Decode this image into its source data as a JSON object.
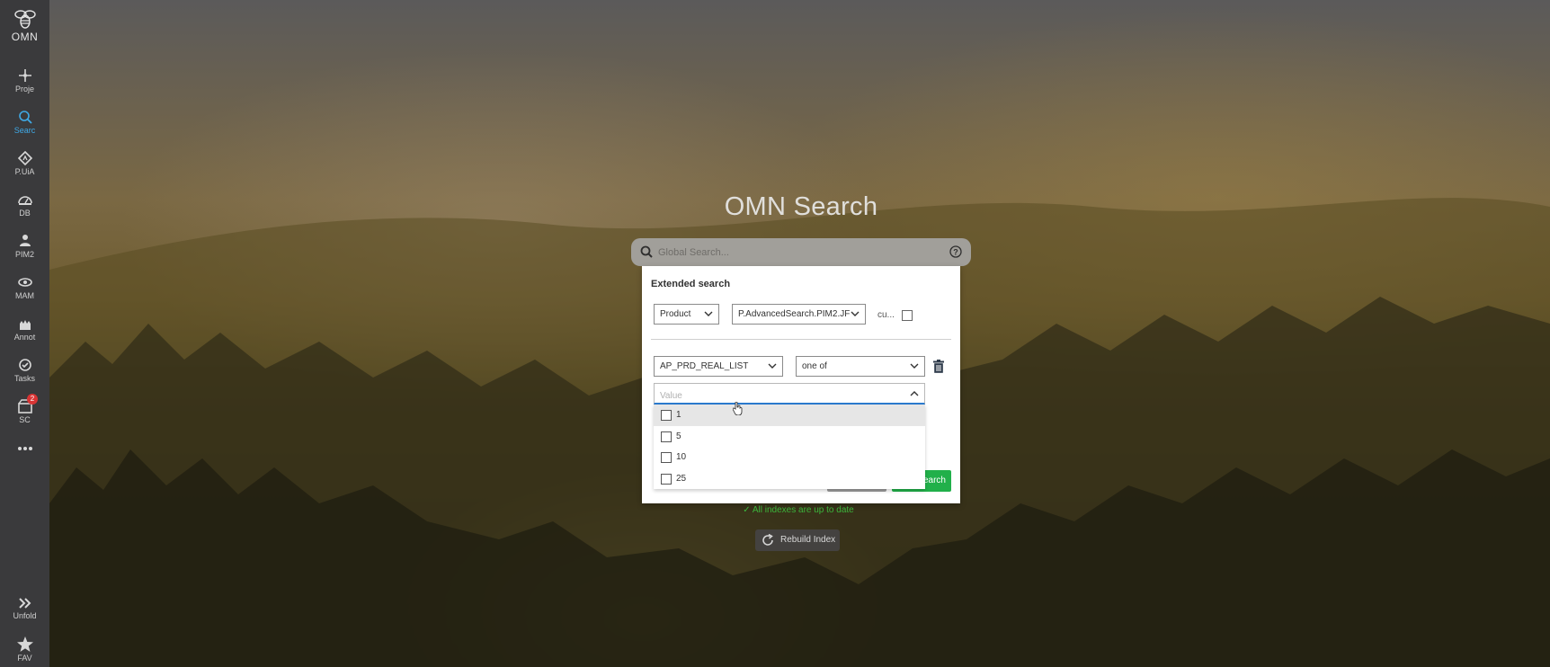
{
  "sidebar": {
    "logo_label": "OMN",
    "items": [
      {
        "label": "Proje",
        "icon": "project-icon"
      },
      {
        "label": "Searc",
        "icon": "search-icon",
        "active": true
      },
      {
        "label": "P.UiA",
        "icon": "pim-ui-icon"
      },
      {
        "label": "DB",
        "icon": "dashboard-icon"
      },
      {
        "label": "PIM2",
        "icon": "pim2-icon"
      },
      {
        "label": "MAM",
        "icon": "mam-icon"
      },
      {
        "label": "Annot",
        "icon": "annotation-icon"
      },
      {
        "label": "Tasks",
        "icon": "tasks-icon"
      },
      {
        "label": "SC",
        "icon": "shopping-cart-icon",
        "badge": "2"
      },
      {
        "label": "Unfold",
        "icon": "unfold-icon"
      },
      {
        "label": "FAV",
        "icon": "star-icon"
      }
    ],
    "more_icon": "more-icon"
  },
  "title": "OMN Search",
  "search": {
    "placeholder": "Global Search..."
  },
  "extended": {
    "title": "Extended search",
    "type_select": "Product",
    "config_select": "P.AdvancedSearch.PIM2.JF",
    "cu_label": "cu...",
    "field_select": "AP_PRD_REAL_LIST",
    "operator_select": "one of",
    "value_placeholder": "Value",
    "options": [
      "1",
      "5",
      "10",
      "25"
    ],
    "search_button": "Search"
  },
  "status": "All indexes are up to date",
  "rebuild_button": "Rebuild Index",
  "colors": {
    "accent": "#3fa9e6",
    "search_button": "#21b04a",
    "status": "#3cb53c",
    "sidebar": "#3a3a3c"
  }
}
